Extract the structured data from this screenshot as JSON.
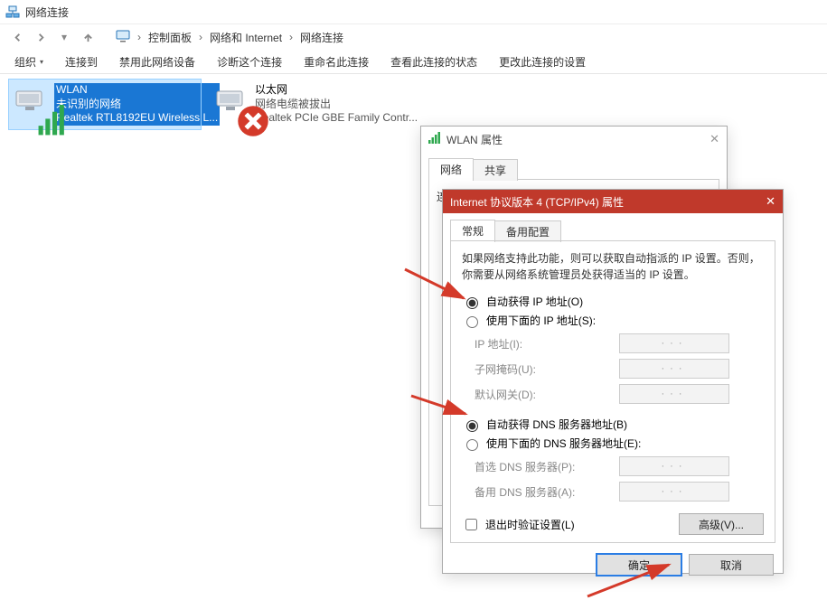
{
  "window": {
    "title": "网络连接"
  },
  "breadcrumb": {
    "items": [
      "控制面板",
      "网络和 Internet",
      "网络连接"
    ]
  },
  "toolbar": {
    "items": [
      "组织",
      "连接到",
      "禁用此网络设备",
      "诊断这个连接",
      "重命名此连接",
      "查看此连接的状态",
      "更改此连接的设置"
    ]
  },
  "adapters": [
    {
      "name": "WLAN",
      "status": "未识别的网络",
      "hardware": "Realtek RTL8192EU Wireless L..."
    },
    {
      "name": "以太网",
      "status": "网络电缆被拔出",
      "hardware": "Realtek PCIe GBE Family Contr..."
    }
  ],
  "wlan_dialog": {
    "title": "WLAN 属性",
    "tabs": [
      "网络",
      "共享"
    ],
    "connect_label_prefix": "连"
  },
  "ipv4_dialog": {
    "title": "Internet 协议版本 4 (TCP/IPv4) 属性",
    "tabs": [
      "常规",
      "备用配置"
    ],
    "description": "如果网络支持此功能，则可以获取自动指派的 IP 设置。否则，你需要从网络系统管理员处获得适当的 IP 设置。",
    "ip_auto": "自动获得 IP 地址(O)",
    "ip_manual": "使用下面的 IP 地址(S):",
    "ip_label": "IP 地址(I):",
    "mask_label": "子网掩码(U):",
    "gateway_label": "默认网关(D):",
    "dns_auto": "自动获得 DNS 服务器地址(B)",
    "dns_manual": "使用下面的 DNS 服务器地址(E):",
    "dns1_label": "首选 DNS 服务器(P):",
    "dns2_label": "备用 DNS 服务器(A):",
    "validate_label": "退出时验证设置(L)",
    "advanced_button": "高级(V)...",
    "ok_button": "确定",
    "cancel_button": "取消"
  }
}
